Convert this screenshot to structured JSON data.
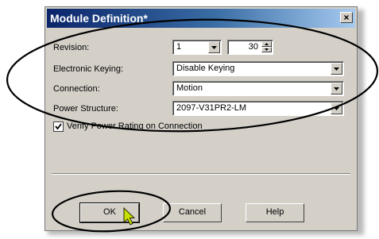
{
  "dialog": {
    "title": "Module Definition*",
    "close_label": "×"
  },
  "form": {
    "revision": {
      "label": "Revision:",
      "major": "1",
      "minor": "30"
    },
    "electronic_keying": {
      "label": "Electronic Keying:",
      "value": "Disable Keying"
    },
    "connection": {
      "label": "Connection:",
      "value": "Motion"
    },
    "power_structure": {
      "label": "Power Structure:",
      "value": "2097-V31PR2-LM"
    },
    "verify_checkbox": {
      "label": "Verify Power Rating on Connection",
      "checked": true
    }
  },
  "buttons": {
    "ok": "OK",
    "cancel": "Cancel",
    "help": "Help"
  },
  "colors": {
    "titlebar_start": "#0a246a",
    "titlebar_end": "#a6caf0",
    "dialog_bg": "#d4d0c8",
    "annotation": "#000000",
    "cursor": "#c8e000"
  },
  "icons": [
    "close-icon",
    "chevron-down-icon",
    "spin-up-icon",
    "spin-down-icon",
    "checkmark-icon",
    "mouse-pointer-icon"
  ]
}
